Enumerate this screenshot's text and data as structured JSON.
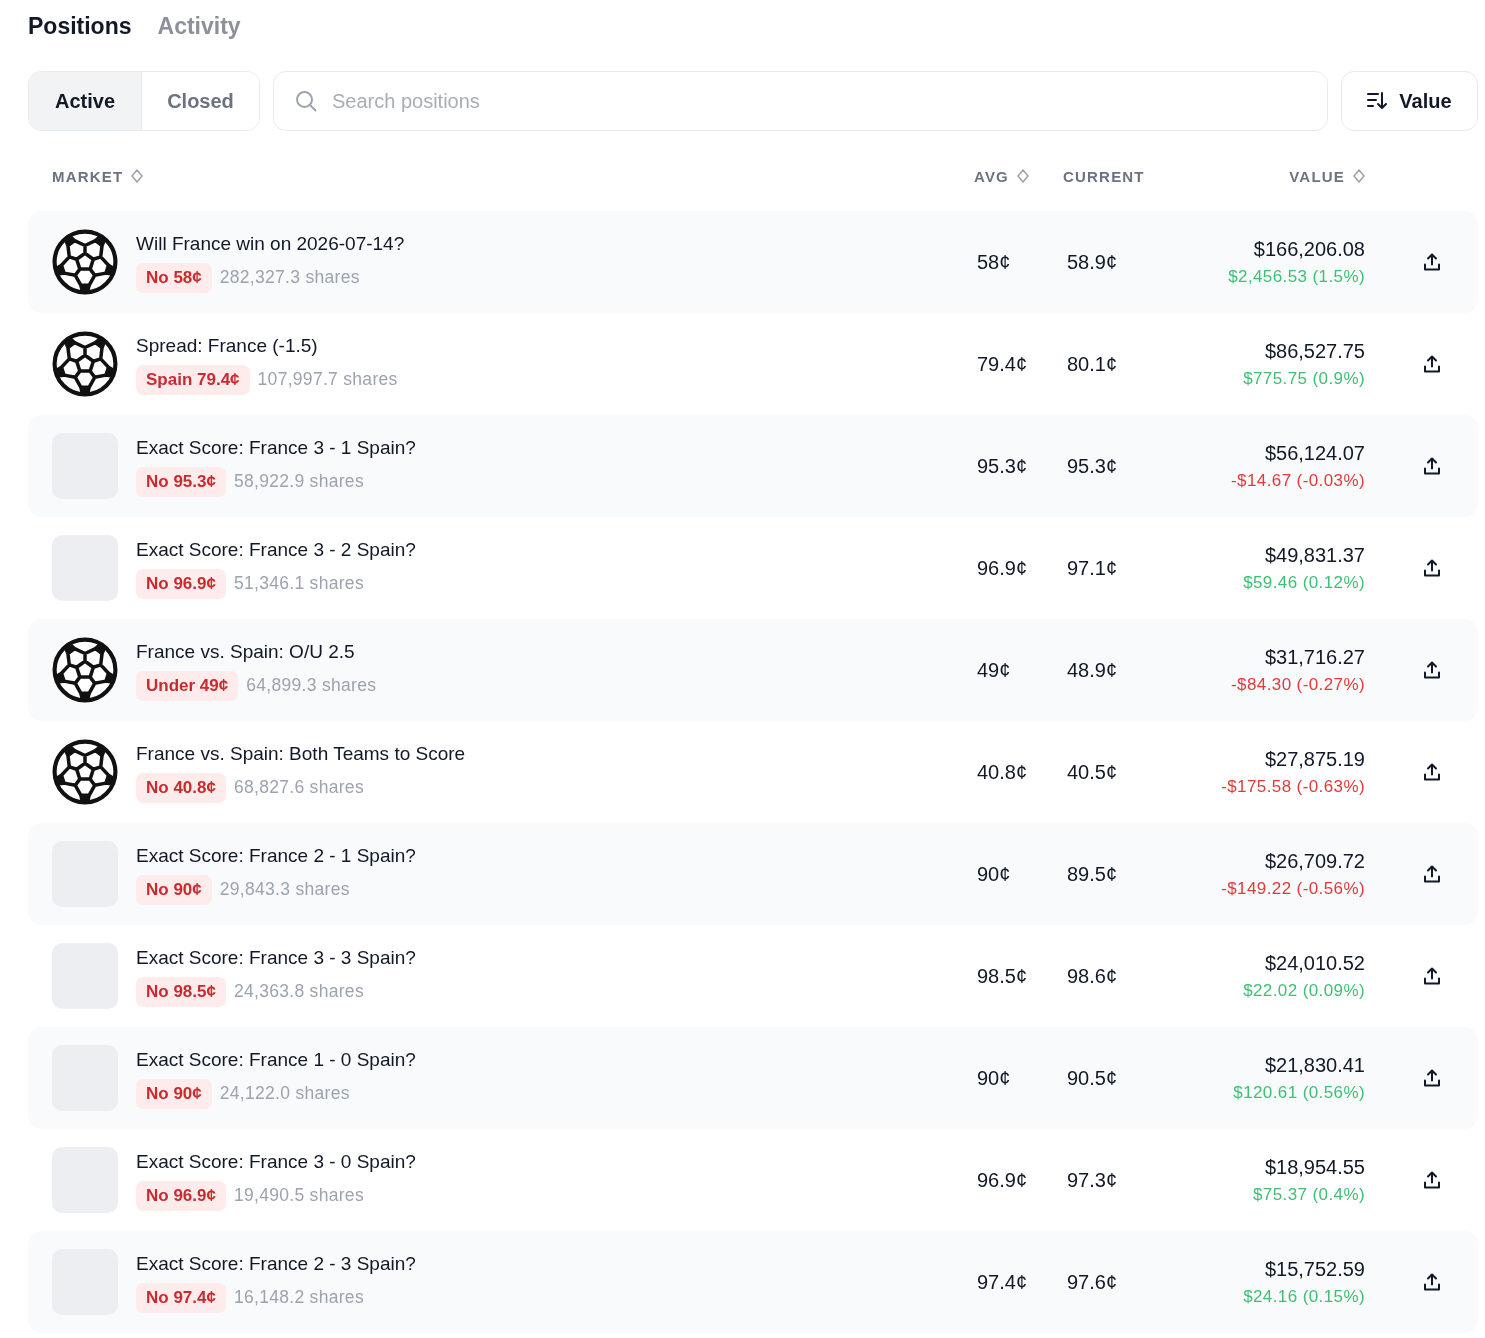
{
  "tabs": [
    {
      "label": "Positions",
      "selected": true
    },
    {
      "label": "Activity",
      "selected": false
    }
  ],
  "filter": [
    {
      "label": "Active",
      "selected": true
    },
    {
      "label": "Closed",
      "selected": false
    }
  ],
  "search": {
    "placeholder": "Search positions"
  },
  "sort_button": {
    "label": "Value"
  },
  "table": {
    "columns": [
      {
        "label": "MARKET",
        "sortable": true
      },
      {
        "label": "AVG",
        "sortable": true
      },
      {
        "label": "CURRENT",
        "sortable": false
      },
      {
        "label": "VALUE",
        "sortable": true
      }
    ],
    "rows": [
      {
        "kind": "ball",
        "title": "Will France win on 2026-07-14?",
        "outcome": "No 58¢",
        "shares": "282,327.3 shares",
        "avg": "58¢",
        "current": "58.9¢",
        "value": "$166,206.08",
        "pnl": "$2,456.53 (1.5%)",
        "loss": false
      },
      {
        "kind": "ball",
        "title": "Spread: France (-1.5)",
        "outcome": "Spain 79.4¢",
        "shares": "107,997.7 shares",
        "avg": "79.4¢",
        "current": "80.1¢",
        "value": "$86,527.75",
        "pnl": "$775.75 (0.9%)",
        "loss": false
      },
      {
        "kind": "blank",
        "title": "Exact Score: France 3 - 1 Spain?",
        "outcome": "No 95.3¢",
        "shares": "58,922.9 shares",
        "avg": "95.3¢",
        "current": "95.3¢",
        "value": "$56,124.07",
        "pnl": "-$14.67 (-0.03%)",
        "loss": true
      },
      {
        "kind": "blank",
        "title": "Exact Score: France 3 - 2 Spain?",
        "outcome": "No 96.9¢",
        "shares": "51,346.1 shares",
        "avg": "96.9¢",
        "current": "97.1¢",
        "value": "$49,831.37",
        "pnl": "$59.46 (0.12%)",
        "loss": false
      },
      {
        "kind": "ball",
        "title": "France vs. Spain: O/U 2.5",
        "outcome": "Under 49¢",
        "shares": "64,899.3 shares",
        "avg": "49¢",
        "current": "48.9¢",
        "value": "$31,716.27",
        "pnl": "-$84.30 (-0.27%)",
        "loss": true
      },
      {
        "kind": "ball",
        "title": "France vs. Spain: Both Teams to Score",
        "outcome": "No 40.8¢",
        "shares": "68,827.6 shares",
        "avg": "40.8¢",
        "current": "40.5¢",
        "value": "$27,875.19",
        "pnl": "-$175.58 (-0.63%)",
        "loss": true
      },
      {
        "kind": "blank",
        "title": "Exact Score: France 2 - 1 Spain?",
        "outcome": "No 90¢",
        "shares": "29,843.3 shares",
        "avg": "90¢",
        "current": "89.5¢",
        "value": "$26,709.72",
        "pnl": "-$149.22 (-0.56%)",
        "loss": true
      },
      {
        "kind": "blank",
        "title": "Exact Score: France 3 - 3 Spain?",
        "outcome": "No 98.5¢",
        "shares": "24,363.8 shares",
        "avg": "98.5¢",
        "current": "98.6¢",
        "value": "$24,010.52",
        "pnl": "$22.02 (0.09%)",
        "loss": false
      },
      {
        "kind": "blank",
        "title": "Exact Score: France 1 - 0 Spain?",
        "outcome": "No 90¢",
        "shares": "24,122.0 shares",
        "avg": "90¢",
        "current": "90.5¢",
        "value": "$21,830.41",
        "pnl": "$120.61 (0.56%)",
        "loss": false
      },
      {
        "kind": "blank",
        "title": "Exact Score: France 3 - 0 Spain?",
        "outcome": "No 96.9¢",
        "shares": "19,490.5 shares",
        "avg": "96.9¢",
        "current": "97.3¢",
        "value": "$18,954.55",
        "pnl": "$75.37 (0.4%)",
        "loss": false
      },
      {
        "kind": "blank",
        "title": "Exact Score: France 2 - 3 Spain?",
        "outcome": "No 97.4¢",
        "shares": "16,148.2 shares",
        "avg": "97.4¢",
        "current": "97.6¢",
        "value": "$15,752.59",
        "pnl": "$24.16 (0.15%)",
        "loss": false
      }
    ]
  }
}
